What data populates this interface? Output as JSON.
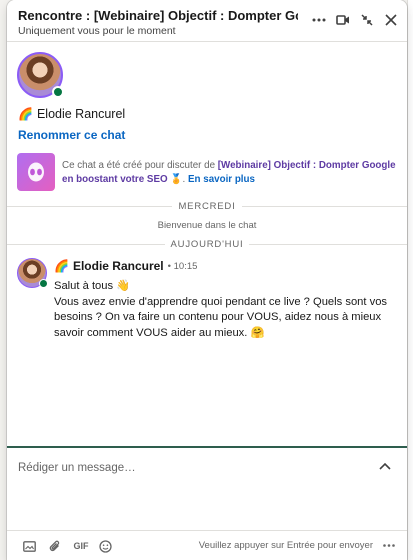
{
  "header": {
    "title": "Rencontre : [Webinaire] Objectif : Dompter Google ...",
    "subtitle": "Uniquement vous pour le moment"
  },
  "profile": {
    "emoji": "🌈",
    "name": "Elodie Rancurel",
    "rename_label": "Renommer ce chat"
  },
  "info": {
    "text_before": "Ce chat a été créé pour discuter de ",
    "event_name": "[Webinaire] Objectif : Dompter Google en boostant votre SEO",
    "event_emoji": "🏅",
    "learn_more": "En savoir plus"
  },
  "timeline": {
    "day1": "MERCREDI",
    "system_message": "Bienvenue dans le chat",
    "day2": "AUJOURD'HUI"
  },
  "message": {
    "emoji": "🌈",
    "sender": "Elodie Rancurel",
    "time": "• 10:15",
    "line1": "Salut à tous 👋",
    "line2": "Vous avez envie d'apprendre quoi pendant ce live ? Quels sont vos besoins ? On va faire un contenu pour VOUS, aidez nous à mieux savoir comment VOUS aider au mieux. 🤗"
  },
  "composer": {
    "placeholder": "Rédiger un message…"
  },
  "footer": {
    "gif_label": "GIF",
    "hint": "Veuillez appuyer sur Entrée pour envoyer"
  },
  "colors": {
    "accent": "#0a66c2",
    "online": "#057642",
    "composer_border": "#2e5e4e"
  }
}
